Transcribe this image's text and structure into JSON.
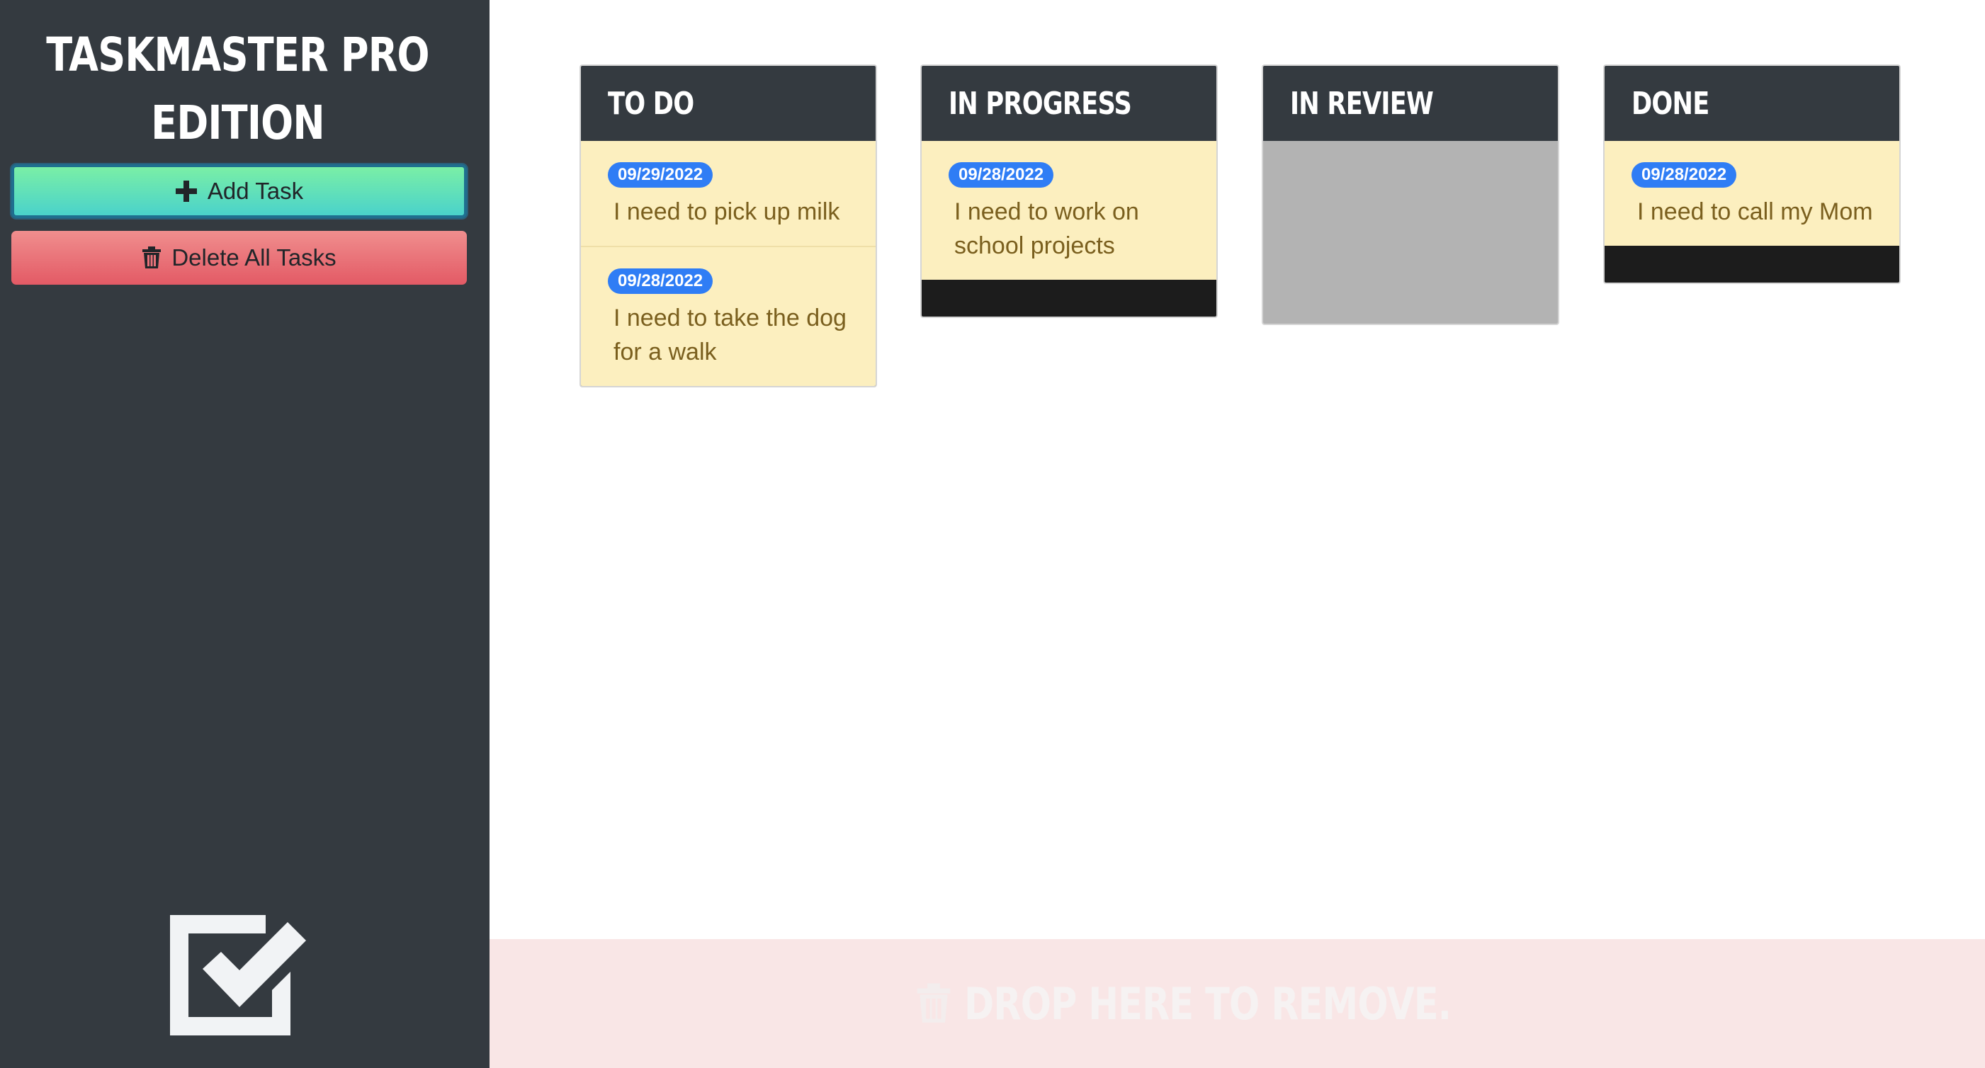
{
  "app": {
    "title_line1": "TASKMASTER PRO",
    "title_line2": "EDITION"
  },
  "sidebar": {
    "add_button": {
      "label": "Add Task",
      "icon": "plus-icon"
    },
    "delete_button": {
      "label": "Delete All Tasks",
      "icon": "trash-icon"
    },
    "logo_icon": "checkbox-checked-icon"
  },
  "columns": [
    {
      "title": "TO DO",
      "cards": [
        {
          "date": "09/29/2022",
          "text": "I need to pick up milk"
        },
        {
          "date": "09/28/2022",
          "text": "I need to take the dog for a walk"
        }
      ]
    },
    {
      "title": "IN PROGRESS",
      "cards": [
        {
          "date": "09/28/2022",
          "text": "I need to work on school projects"
        }
      ]
    },
    {
      "title": "IN REVIEW",
      "cards": []
    },
    {
      "title": "DONE",
      "cards": [
        {
          "date": "09/28/2022",
          "text": "I need to call my Mom"
        }
      ]
    }
  ],
  "drop_zone": {
    "label": "DROP HERE TO REMOVE.",
    "icon": "trash-icon"
  },
  "colors": {
    "sidebar_bg": "#343a40",
    "card_bg": "#fcefbf",
    "badge_bg": "#2f7df5",
    "add_gradient_top": "#7aefa6",
    "add_gradient_bottom": "#4ad2cb",
    "delete_gradient_top": "#f08e8e",
    "delete_gradient_bottom": "#e35a65",
    "drop_zone_bg": "#f9e6e6"
  }
}
